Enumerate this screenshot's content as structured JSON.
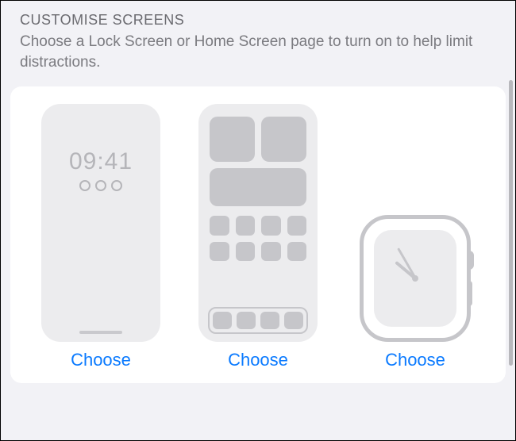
{
  "header": {
    "title": "CUSTOMISE SCREENS",
    "subtitle": "Choose a Lock Screen or Home Screen page to turn on to help limit distractions."
  },
  "lock_screen": {
    "time": "09:41",
    "choose_label": "Choose"
  },
  "home_screen": {
    "choose_label": "Choose"
  },
  "watch": {
    "choose_label": "Choose"
  }
}
